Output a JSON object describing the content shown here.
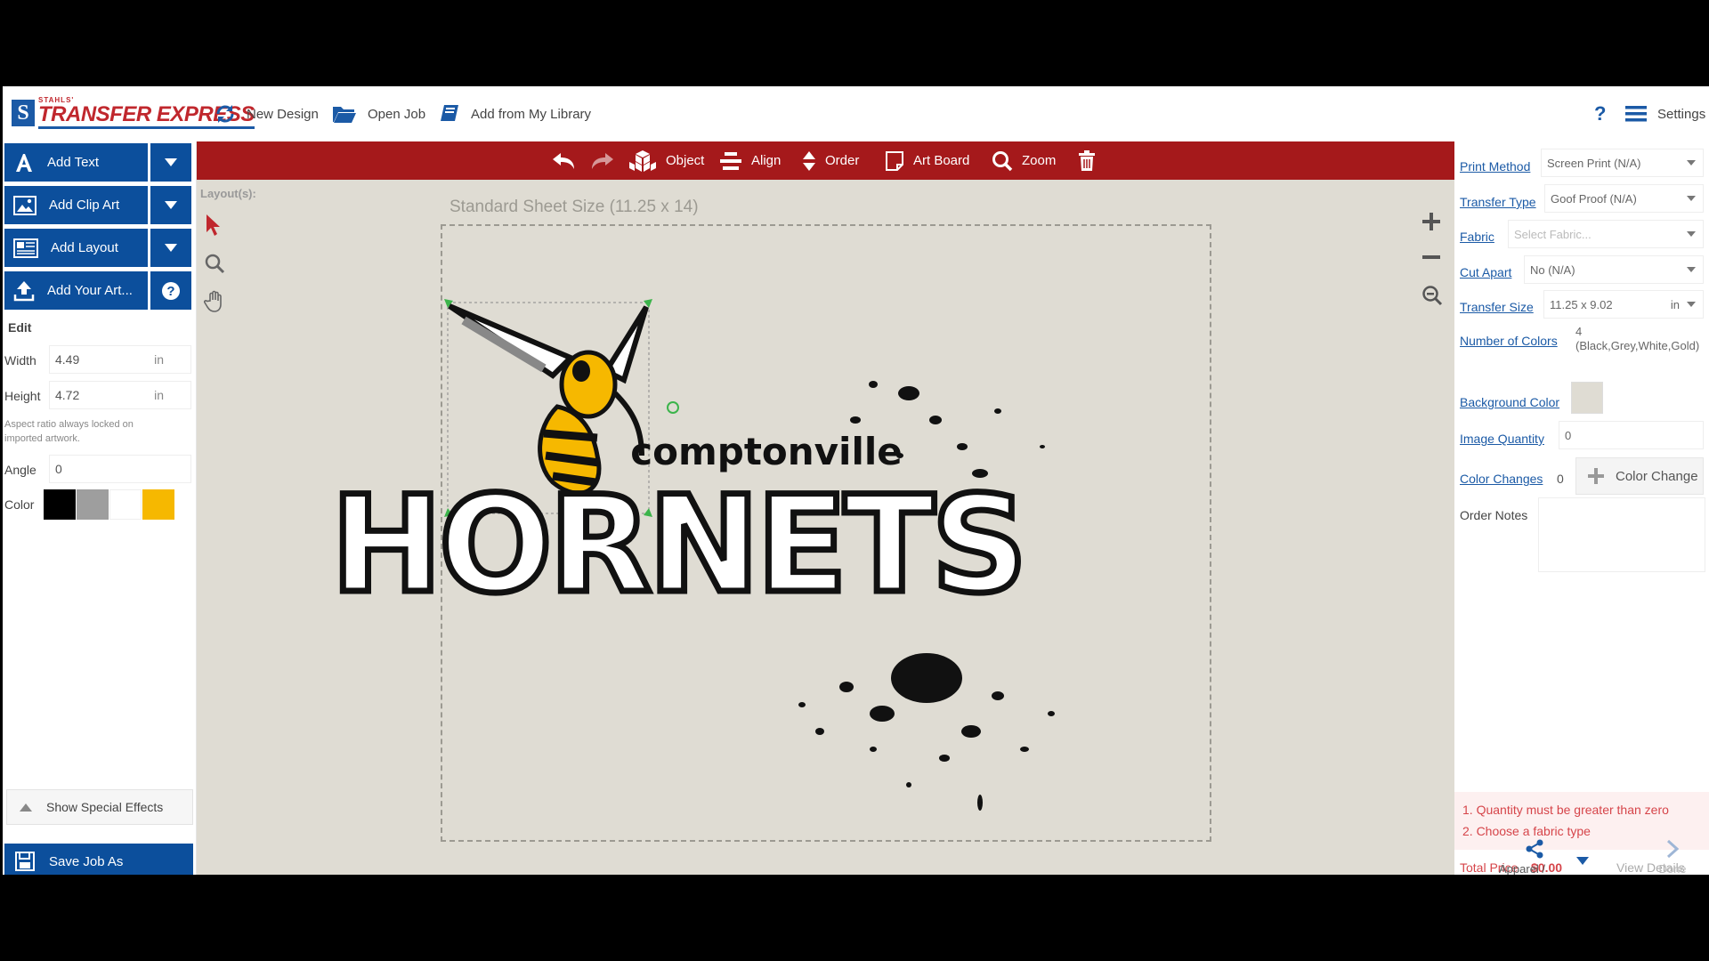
{
  "brand": {
    "small": "STAHLS'",
    "name": "TRANSFER EXPRESS",
    "mark": "S"
  },
  "topnav": {
    "new_design": "New Design",
    "open_job": "Open Job",
    "add_library": "Add from My Library",
    "help": "?",
    "settings": "Settings"
  },
  "toolbar": {
    "object": "Object",
    "align": "Align",
    "order": "Order",
    "art_board": "Art Board",
    "zoom": "Zoom"
  },
  "left": {
    "add_text": "Add Text",
    "add_clip_art": "Add Clip Art",
    "add_layout": "Add Layout",
    "add_art": "Add Your Art...",
    "edit_heading": "Edit",
    "width_label": "Width",
    "width_value": "4.49",
    "width_unit": "in",
    "height_label": "Height",
    "height_value": "4.72",
    "height_unit": "in",
    "aspect_note": "Aspect ratio always locked on imported artwork.",
    "angle_label": "Angle",
    "angle_value": "0",
    "color_label": "Color",
    "colors": [
      "#000000",
      "#9e9e9e",
      "#ffffff",
      "#f6b800"
    ],
    "special_effects": "Show Special Effects",
    "save_job": "Save Job As"
  },
  "canvas": {
    "layouts_label": "Layout(s):",
    "sheet_title": "Standard Sheet Size (11.25 x 14)",
    "art_text_top": "comptonville",
    "art_text_main": "HORNETS"
  },
  "right": {
    "print_method_label": "Print Method",
    "print_method_value": "Screen Print (N/A)",
    "transfer_type_label": "Transfer Type",
    "transfer_type_value": "Goof Proof (N/A)",
    "fabric_label": "Fabric",
    "fabric_placeholder": "Select Fabric...",
    "cut_apart_label": "Cut Apart",
    "cut_apart_value": "No (N/A)",
    "transfer_size_label": "Transfer Size",
    "transfer_size_value": "11.25 x 9.02",
    "transfer_size_unit": "in",
    "num_colors_label": "Number of Colors",
    "num_colors_value": "4",
    "num_colors_detail": "(Black,Grey,White,Gold)",
    "bg_color_label": "Background Color",
    "image_qty_label": "Image Quantity",
    "image_qty_value": "0",
    "color_changes_label": "Color Changes",
    "color_changes_value": "0",
    "color_change_button": "Color Change",
    "order_notes_label": "Order Notes",
    "error_1": "1. Quantity must be greater than zero",
    "error_2": "2. Choose a fabric type",
    "total_price_label": "Total Price",
    "total_price_value": "$0.00",
    "view_details": "View Details",
    "share_label": "Apparel / Share",
    "done_label": "Done"
  }
}
